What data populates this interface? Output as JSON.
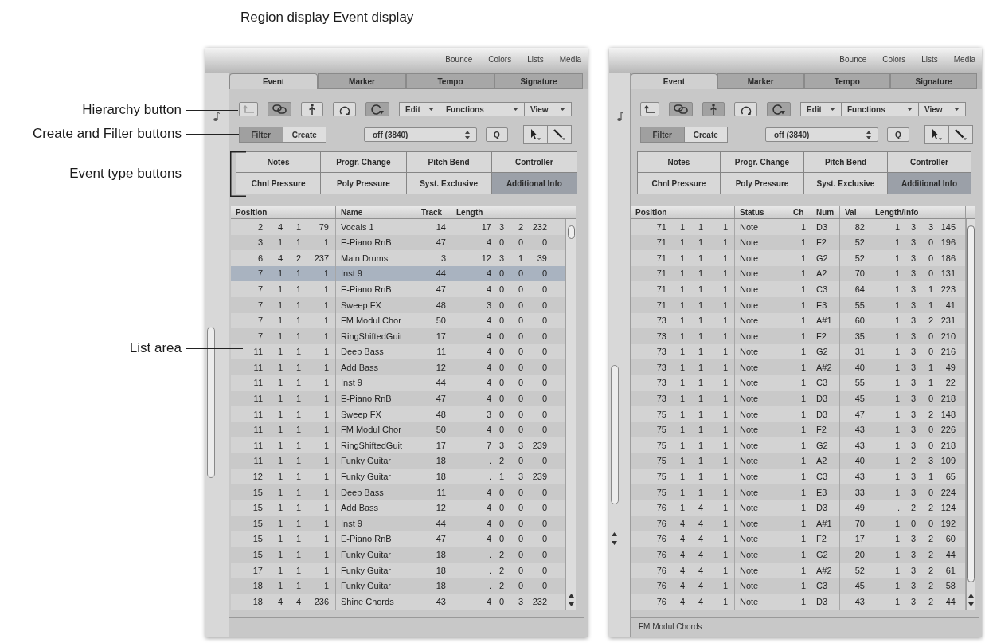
{
  "annotations": {
    "title": "Region display Event display",
    "labels": [
      "Hierarchy button",
      "Create and Filter buttons",
      "Event type buttons",
      "List area"
    ]
  },
  "panels": [
    {
      "menu": [
        "Bounce",
        "Colors",
        "Lists",
        "Media"
      ],
      "tabs": [
        {
          "label": "Event",
          "selected": true
        },
        {
          "label": "Marker",
          "selected": false
        },
        {
          "label": "Tempo",
          "selected": false
        },
        {
          "label": "Signature",
          "selected": false
        }
      ],
      "icon_buttons": [
        {
          "on": false,
          "disabled": true
        },
        {
          "on": true,
          "disabled": false
        },
        {
          "on": false,
          "disabled": false
        },
        {
          "on": false,
          "disabled": false
        },
        {
          "on": true,
          "disabled": false
        }
      ],
      "menus": [
        "Edit",
        "Functions",
        "View"
      ],
      "modes": [
        {
          "label": "Filter",
          "selected": true
        },
        {
          "label": "Create",
          "selected": false
        }
      ],
      "quantize": {
        "value": "off (3840)"
      },
      "q_button": "Q",
      "event_types": [
        {
          "label": "Notes",
          "selected": false
        },
        {
          "label": "Progr. Change",
          "selected": false
        },
        {
          "label": "Pitch Bend",
          "selected": false
        },
        {
          "label": "Controller",
          "selected": false
        },
        {
          "label": "Chnl Pressure",
          "selected": false
        },
        {
          "label": "Poly Pressure",
          "selected": false
        },
        {
          "label": "Syst. Exclusive",
          "selected": false
        },
        {
          "label": "Additional Info",
          "selected": true
        }
      ],
      "table": {
        "columns": [
          {
            "label": "Position",
            "kind": "fields"
          },
          {
            "label": "Name",
            "kind": "text"
          },
          {
            "label": "Track",
            "kind": "number"
          },
          {
            "label": "Length",
            "kind": "fields"
          }
        ],
        "rows": [
          {
            "cells": [
              [
                "2",
                "4",
                "1",
                "79"
              ],
              "Vocals 1",
              "14",
              [
                "17",
                "3",
                "2",
                "232"
              ]
            ],
            "selected": false
          },
          {
            "cells": [
              [
                "3",
                "1",
                "1",
                "1"
              ],
              "E-Piano RnB",
              "47",
              [
                "4",
                "0",
                "0",
                "0"
              ]
            ],
            "selected": false
          },
          {
            "cells": [
              [
                "6",
                "4",
                "2",
                "237"
              ],
              "Main Drums",
              "3",
              [
                "12",
                "3",
                "1",
                "39"
              ]
            ],
            "selected": false
          },
          {
            "cells": [
              [
                "7",
                "1",
                "1",
                "1"
              ],
              "Inst 9",
              "44",
              [
                "4",
                "0",
                "0",
                "0"
              ]
            ],
            "selected": true
          },
          {
            "cells": [
              [
                "7",
                "1",
                "1",
                "1"
              ],
              "E-Piano RnB",
              "47",
              [
                "4",
                "0",
                "0",
                "0"
              ]
            ],
            "selected": false
          },
          {
            "cells": [
              [
                "7",
                "1",
                "1",
                "1"
              ],
              "Sweep FX",
              "48",
              [
                "3",
                "0",
                "0",
                "0"
              ]
            ],
            "selected": false
          },
          {
            "cells": [
              [
                "7",
                "1",
                "1",
                "1"
              ],
              "FM Modul Chor",
              "50",
              [
                "4",
                "0",
                "0",
                "0"
              ]
            ],
            "selected": false
          },
          {
            "cells": [
              [
                "7",
                "1",
                "1",
                "1"
              ],
              "RingShiftedGuit",
              "17",
              [
                "4",
                "0",
                "0",
                "0"
              ]
            ],
            "selected": false
          },
          {
            "cells": [
              [
                "11",
                "1",
                "1",
                "1"
              ],
              "Deep Bass",
              "11",
              [
                "4",
                "0",
                "0",
                "0"
              ]
            ],
            "selected": false
          },
          {
            "cells": [
              [
                "11",
                "1",
                "1",
                "1"
              ],
              "Add Bass",
              "12",
              [
                "4",
                "0",
                "0",
                "0"
              ]
            ],
            "selected": false
          },
          {
            "cells": [
              [
                "11",
                "1",
                "1",
                "1"
              ],
              "Inst 9",
              "44",
              [
                "4",
                "0",
                "0",
                "0"
              ]
            ],
            "selected": false
          },
          {
            "cells": [
              [
                "11",
                "1",
                "1",
                "1"
              ],
              "E-Piano RnB",
              "47",
              [
                "4",
                "0",
                "0",
                "0"
              ]
            ],
            "selected": false
          },
          {
            "cells": [
              [
                "11",
                "1",
                "1",
                "1"
              ],
              "Sweep FX",
              "48",
              [
                "3",
                "0",
                "0",
                "0"
              ]
            ],
            "selected": false
          },
          {
            "cells": [
              [
                "11",
                "1",
                "1",
                "1"
              ],
              "FM Modul Chor",
              "50",
              [
                "4",
                "0",
                "0",
                "0"
              ]
            ],
            "selected": false
          },
          {
            "cells": [
              [
                "11",
                "1",
                "1",
                "1"
              ],
              "RingShiftedGuit",
              "17",
              [
                "7",
                "3",
                "3",
                "239"
              ]
            ],
            "selected": false
          },
          {
            "cells": [
              [
                "11",
                "1",
                "1",
                "1"
              ],
              "Funky Guitar",
              "18",
              [
                ".",
                "2",
                "0",
                "0"
              ]
            ],
            "selected": false
          },
          {
            "cells": [
              [
                "12",
                "1",
                "1",
                "1"
              ],
              "Funky Guitar",
              "18",
              [
                ".",
                "1",
                "3",
                "239"
              ]
            ],
            "selected": false
          },
          {
            "cells": [
              [
                "15",
                "1",
                "1",
                "1"
              ],
              "Deep Bass",
              "11",
              [
                "4",
                "0",
                "0",
                "0"
              ]
            ],
            "selected": false
          },
          {
            "cells": [
              [
                "15",
                "1",
                "1",
                "1"
              ],
              "Add Bass",
              "12",
              [
                "4",
                "0",
                "0",
                "0"
              ]
            ],
            "selected": false
          },
          {
            "cells": [
              [
                "15",
                "1",
                "1",
                "1"
              ],
              "Inst 9",
              "44",
              [
                "4",
                "0",
                "0",
                "0"
              ]
            ],
            "selected": false
          },
          {
            "cells": [
              [
                "15",
                "1",
                "1",
                "1"
              ],
              "E-Piano RnB",
              "47",
              [
                "4",
                "0",
                "0",
                "0"
              ]
            ],
            "selected": false
          },
          {
            "cells": [
              [
                "15",
                "1",
                "1",
                "1"
              ],
              "Funky Guitar",
              "18",
              [
                ".",
                "2",
                "0",
                "0"
              ]
            ],
            "selected": false
          },
          {
            "cells": [
              [
                "17",
                "1",
                "1",
                "1"
              ],
              "Funky Guitar",
              "18",
              [
                ".",
                "2",
                "0",
                "0"
              ]
            ],
            "selected": false
          },
          {
            "cells": [
              [
                "18",
                "1",
                "1",
                "1"
              ],
              "Funky Guitar",
              "18",
              [
                ".",
                "2",
                "0",
                "0"
              ]
            ],
            "selected": false
          },
          {
            "cells": [
              [
                "18",
                "4",
                "4",
                "236"
              ],
              "Shine Chords",
              "43",
              [
                "4",
                "0",
                "3",
                "232"
              ]
            ],
            "selected": false
          }
        ]
      }
    },
    {
      "menu": [
        "Bounce",
        "Colors",
        "Lists",
        "Media"
      ],
      "tabs": [
        {
          "label": "Event",
          "selected": true
        },
        {
          "label": "Marker",
          "selected": false
        },
        {
          "label": "Tempo",
          "selected": false
        },
        {
          "label": "Signature",
          "selected": false
        }
      ],
      "icon_buttons": [
        {
          "on": false,
          "disabled": false
        },
        {
          "on": true,
          "disabled": false
        },
        {
          "on": true,
          "disabled": false
        },
        {
          "on": false,
          "disabled": false
        },
        {
          "on": true,
          "disabled": false
        }
      ],
      "menus": [
        "Edit",
        "Functions",
        "View"
      ],
      "modes": [
        {
          "label": "Filter",
          "selected": true
        },
        {
          "label": "Create",
          "selected": false
        }
      ],
      "quantize": {
        "value": "off (3840)"
      },
      "q_button": "Q",
      "event_types": [
        {
          "label": "Notes",
          "selected": false
        },
        {
          "label": "Progr. Change",
          "selected": false
        },
        {
          "label": "Pitch Bend",
          "selected": false
        },
        {
          "label": "Controller",
          "selected": false
        },
        {
          "label": "Chnl Pressure",
          "selected": false
        },
        {
          "label": "Poly Pressure",
          "selected": false
        },
        {
          "label": "Syst. Exclusive",
          "selected": false
        },
        {
          "label": "Additional Info",
          "selected": true
        }
      ],
      "table": {
        "columns": [
          {
            "label": "Position",
            "kind": "fields"
          },
          {
            "label": "Status",
            "kind": "text"
          },
          {
            "label": "Ch",
            "kind": "number"
          },
          {
            "label": "Num",
            "kind": "text"
          },
          {
            "label": "Val",
            "kind": "number"
          },
          {
            "label": "Length/Info",
            "kind": "fields"
          }
        ],
        "rows": [
          {
            "cells": [
              [
                "71",
                "1",
                "1",
                "1"
              ],
              "Note",
              "1",
              "D3",
              "82",
              [
                "1",
                "3",
                "3",
                "145"
              ]
            ],
            "selected": false
          },
          {
            "cells": [
              [
                "71",
                "1",
                "1",
                "1"
              ],
              "Note",
              "1",
              "F2",
              "52",
              [
                "1",
                "3",
                "0",
                "196"
              ]
            ],
            "selected": false
          },
          {
            "cells": [
              [
                "71",
                "1",
                "1",
                "1"
              ],
              "Note",
              "1",
              "G2",
              "52",
              [
                "1",
                "3",
                "0",
                "186"
              ]
            ],
            "selected": false
          },
          {
            "cells": [
              [
                "71",
                "1",
                "1",
                "1"
              ],
              "Note",
              "1",
              "A2",
              "70",
              [
                "1",
                "3",
                "0",
                "131"
              ]
            ],
            "selected": false
          },
          {
            "cells": [
              [
                "71",
                "1",
                "1",
                "1"
              ],
              "Note",
              "1",
              "C3",
              "64",
              [
                "1",
                "3",
                "1",
                "223"
              ]
            ],
            "selected": false
          },
          {
            "cells": [
              [
                "71",
                "1",
                "1",
                "1"
              ],
              "Note",
              "1",
              "E3",
              "55",
              [
                "1",
                "3",
                "1",
                "41"
              ]
            ],
            "selected": false
          },
          {
            "cells": [
              [
                "73",
                "1",
                "1",
                "1"
              ],
              "Note",
              "1",
              "A#1",
              "60",
              [
                "1",
                "3",
                "2",
                "231"
              ]
            ],
            "selected": false
          },
          {
            "cells": [
              [
                "73",
                "1",
                "1",
                "1"
              ],
              "Note",
              "1",
              "F2",
              "35",
              [
                "1",
                "3",
                "0",
                "210"
              ]
            ],
            "selected": false
          },
          {
            "cells": [
              [
                "73",
                "1",
                "1",
                "1"
              ],
              "Note",
              "1",
              "G2",
              "31",
              [
                "1",
                "3",
                "0",
                "216"
              ]
            ],
            "selected": false
          },
          {
            "cells": [
              [
                "73",
                "1",
                "1",
                "1"
              ],
              "Note",
              "1",
              "A#2",
              "40",
              [
                "1",
                "3",
                "1",
                "49"
              ]
            ],
            "selected": false
          },
          {
            "cells": [
              [
                "73",
                "1",
                "1",
                "1"
              ],
              "Note",
              "1",
              "C3",
              "55",
              [
                "1",
                "3",
                "1",
                "22"
              ]
            ],
            "selected": false
          },
          {
            "cells": [
              [
                "73",
                "1",
                "1",
                "1"
              ],
              "Note",
              "1",
              "D3",
              "45",
              [
                "1",
                "3",
                "0",
                "218"
              ]
            ],
            "selected": false
          },
          {
            "cells": [
              [
                "75",
                "1",
                "1",
                "1"
              ],
              "Note",
              "1",
              "D3",
              "47",
              [
                "1",
                "3",
                "2",
                "148"
              ]
            ],
            "selected": false
          },
          {
            "cells": [
              [
                "75",
                "1",
                "1",
                "1"
              ],
              "Note",
              "1",
              "F2",
              "43",
              [
                "1",
                "3",
                "0",
                "226"
              ]
            ],
            "selected": false
          },
          {
            "cells": [
              [
                "75",
                "1",
                "1",
                "1"
              ],
              "Note",
              "1",
              "G2",
              "43",
              [
                "1",
                "3",
                "0",
                "218"
              ]
            ],
            "selected": false
          },
          {
            "cells": [
              [
                "75",
                "1",
                "1",
                "1"
              ],
              "Note",
              "1",
              "A2",
              "40",
              [
                "1",
                "2",
                "3",
                "109"
              ]
            ],
            "selected": false
          },
          {
            "cells": [
              [
                "75",
                "1",
                "1",
                "1"
              ],
              "Note",
              "1",
              "C3",
              "43",
              [
                "1",
                "3",
                "1",
                "65"
              ]
            ],
            "selected": false
          },
          {
            "cells": [
              [
                "75",
                "1",
                "1",
                "1"
              ],
              "Note",
              "1",
              "E3",
              "33",
              [
                "1",
                "3",
                "0",
                "224"
              ]
            ],
            "selected": false
          },
          {
            "cells": [
              [
                "76",
                "1",
                "4",
                "1"
              ],
              "Note",
              "1",
              "D3",
              "49",
              [
                ".",
                "2",
                "2",
                "124"
              ]
            ],
            "selected": false
          },
          {
            "cells": [
              [
                "76",
                "4",
                "4",
                "1"
              ],
              "Note",
              "1",
              "A#1",
              "70",
              [
                "1",
                "0",
                "0",
                "192"
              ]
            ],
            "selected": false
          },
          {
            "cells": [
              [
                "76",
                "4",
                "4",
                "1"
              ],
              "Note",
              "1",
              "F2",
              "17",
              [
                "1",
                "3",
                "2",
                "60"
              ]
            ],
            "selected": false
          },
          {
            "cells": [
              [
                "76",
                "4",
                "4",
                "1"
              ],
              "Note",
              "1",
              "G2",
              "20",
              [
                "1",
                "3",
                "2",
                "44"
              ]
            ],
            "selected": false
          },
          {
            "cells": [
              [
                "76",
                "4",
                "4",
                "1"
              ],
              "Note",
              "1",
              "A#2",
              "52",
              [
                "1",
                "3",
                "2",
                "61"
              ]
            ],
            "selected": false
          },
          {
            "cells": [
              [
                "76",
                "4",
                "4",
                "1"
              ],
              "Note",
              "1",
              "C3",
              "45",
              [
                "1",
                "3",
                "2",
                "58"
              ]
            ],
            "selected": false
          },
          {
            "cells": [
              [
                "76",
                "4",
                "4",
                "1"
              ],
              "Note",
              "1",
              "D3",
              "43",
              [
                "1",
                "3",
                "2",
                "44"
              ]
            ],
            "selected": false
          }
        ]
      },
      "status_bar": "FM Modul Chords"
    }
  ]
}
